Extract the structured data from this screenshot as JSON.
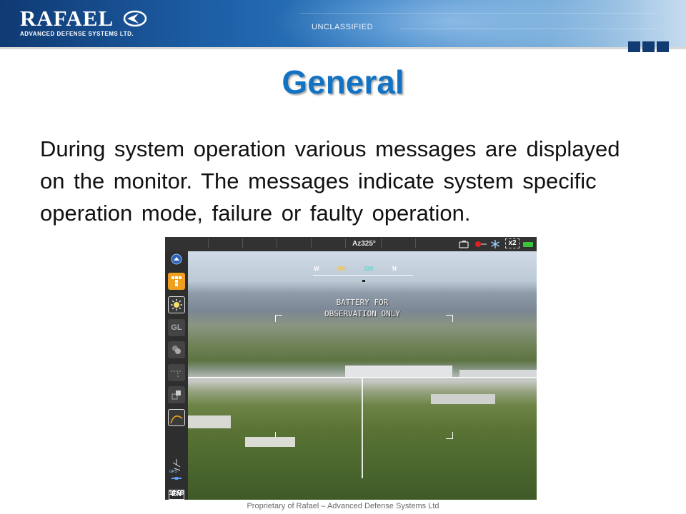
{
  "header": {
    "logo_name": "RAFAEL",
    "logo_sub": "ADVANCED DEFENSE SYSTEMS LTD.",
    "classification": "UNCLASSIFIED"
  },
  "slide": {
    "title": "General",
    "body": "During system operation various messages are displayed on the monitor. The messages indicate system specific operation mode, failure or faulty operation."
  },
  "device": {
    "azimuth": "Az325°",
    "zoom": "x2",
    "compass": [
      "W",
      "300",
      "330",
      "N"
    ],
    "compass_colors": [
      "#9fd86a",
      "#f5c542",
      "#62d4c8",
      "#e8e8ff"
    ],
    "message_line1": "BATTERY FOR",
    "message_line2": "OBSERVATION ONLY",
    "sidebar_labels": {
      "gl": "GL",
      "gps": "GPS",
      "lang": "EN"
    },
    "time": "13:58",
    "icons": [
      "menu-up-icon",
      "grid-mode-icon",
      "brightness-icon",
      "gl-icon",
      "color-icon",
      "crosshair-icon",
      "window-icon",
      "ballistic-curve-icon",
      "compass-north-icon",
      "gps-satellite-icon",
      "camera-icon",
      "record-icon",
      "snowflake-icon",
      "battery-icon"
    ],
    "accent_orange": "#f0a01e",
    "battery_color": "#39c439",
    "record_color": "#e02020"
  },
  "footer": {
    "text": "Proprietary of Rafael – Advanced Defense Systems Ltd"
  }
}
